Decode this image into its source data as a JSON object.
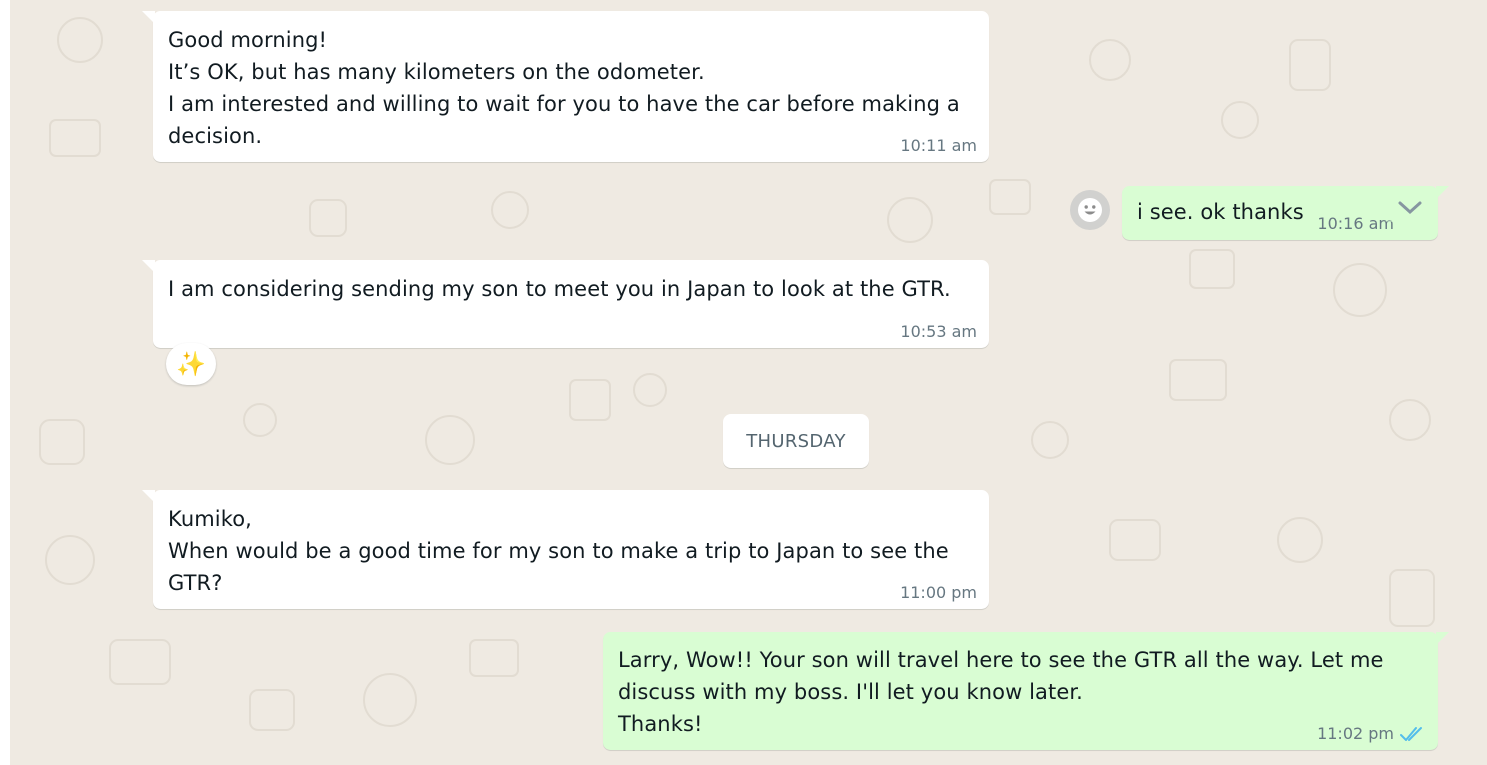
{
  "messages": [
    {
      "direction": "incoming",
      "text": "Good morning!\nIt’s OK, but has many kilometers on the odometer.\nI am interested and willing to wait for you to have the car before making a\ndecision.",
      "time": "10:11 am"
    },
    {
      "direction": "outgoing",
      "text": "i see. ok thanks",
      "time": "10:16 am"
    },
    {
      "direction": "incoming",
      "text": "I am considering sending my son to meet you in Japan to look at the GTR.",
      "time": "10:53 am",
      "reaction": "✨"
    },
    {
      "direction": "incoming",
      "text": "Kumiko,\nWhen would be a good time for my son to make a trip to Japan to see the\nGTR?",
      "time": "11:00 pm"
    },
    {
      "direction": "outgoing",
      "text": "Larry, Wow!! Your son will travel here to see the GTR all the way. Let me\ndiscuss with my boss. I'll let you know later.\nThanks!",
      "time": "11:02 pm",
      "status": "read"
    }
  ],
  "day_divider": "THURSDAY",
  "icons": {
    "emoji_react": "smiley-icon",
    "message_menu": "chevron-down-icon",
    "read_receipt": "double-check-icon",
    "reaction": "sparkles-icon"
  },
  "colors": {
    "background": "#efeae2",
    "incoming_bubble": "#ffffff",
    "outgoing_bubble": "#d9fdd3",
    "read_tick": "#53bdeb",
    "timestamp": "#667781"
  }
}
